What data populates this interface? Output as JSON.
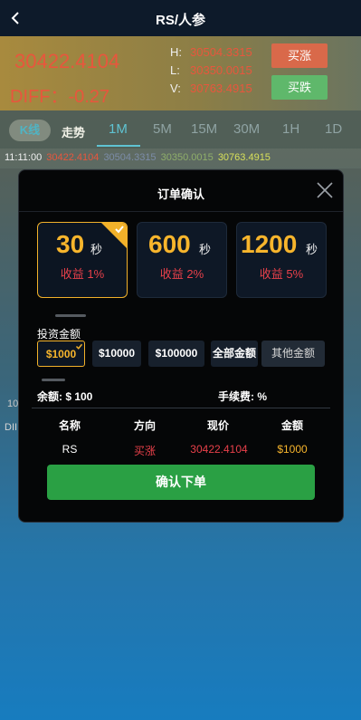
{
  "header": {
    "title": "RS/人参",
    "back_icon": "chevron-left-icon"
  },
  "quote": {
    "price": "30422.4104",
    "diff_label": "DIFF：",
    "diff_value": "-0.27",
    "high_label": "H:",
    "high_value": "30504.3315",
    "low_label": "L:",
    "low_value": "30350.0015",
    "vol_label": "V:",
    "vol_value": "30763.4915",
    "buy_up": "买涨",
    "buy_down": "买跌"
  },
  "tabs": {
    "kline": "K线",
    "trend": "走势",
    "timeframes": [
      "1M",
      "5M",
      "15M",
      "30M",
      "1H",
      "1D"
    ],
    "active": "1M"
  },
  "ticker": {
    "time": "11:11:00",
    "open": "30422.4104",
    "high": "30504.3315",
    "low": "30350.0015",
    "close": "30763.4915"
  },
  "side": {
    "label1": "10",
    "label2": "DII"
  },
  "modal": {
    "title": "订单确认",
    "close_icon": "close-icon",
    "periods": [
      {
        "seconds": "30",
        "unit": "秒",
        "yield": "收益 1%",
        "selected": true
      },
      {
        "seconds": "600",
        "unit": "秒",
        "yield": "收益 2%",
        "selected": false
      },
      {
        "seconds": "1200",
        "unit": "秒",
        "yield": "收益 5%",
        "selected": false
      }
    ],
    "invest_label": "投资金额",
    "amounts": [
      "$1000",
      "$10000",
      "$100000",
      "全部金额",
      "其他金额"
    ],
    "selected_amount": "$1000",
    "balance": "余额: $ 100",
    "fee": "手续费: %",
    "table": {
      "headers": [
        "名称",
        "方向",
        "现价",
        "金额"
      ],
      "row": [
        "RS",
        "买涨",
        "30422.4104",
        "$1000"
      ]
    },
    "confirm": "确认下单"
  },
  "colors": {
    "up": "#e8563d",
    "down": "#5fb86b",
    "accent": "#f2b12a",
    "confirm": "#2aa044",
    "buy_up_text": "#e8404a",
    "amount_text": "#f7b52c"
  }
}
